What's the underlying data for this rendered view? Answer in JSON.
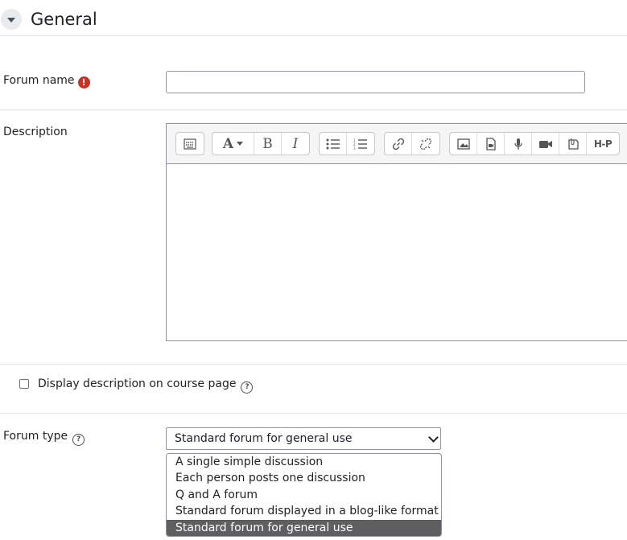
{
  "section": {
    "title": "General"
  },
  "forum_name": {
    "label": "Forum name",
    "value": "",
    "required_mark": "!"
  },
  "description": {
    "label": "Description",
    "value": ""
  },
  "toolbar": {
    "groups": [
      [
        "toggle-toolbar-icon"
      ],
      [
        "font-style-icon",
        "bold-icon",
        "italic-icon"
      ],
      [
        "unordered-list-icon",
        "ordered-list-icon"
      ],
      [
        "link-icon",
        "unlink-icon"
      ],
      [
        "image-icon",
        "media-icon",
        "record-audio-icon",
        "record-video-icon",
        "manage-files-icon",
        "h5p-icon"
      ]
    ],
    "bold_label": "B",
    "italic_label": "I",
    "font_label": "A",
    "h5p_label": "H-P"
  },
  "display_description": {
    "label": "Display description on course page",
    "checked": false,
    "help": "?"
  },
  "forum_type": {
    "label": "Forum type",
    "help": "?",
    "selected": "Standard forum for general use",
    "options": [
      "A single simple discussion",
      "Each person posts one discussion",
      "Q and A forum",
      "Standard forum displayed in a blog-like format",
      "Standard forum for general use"
    ],
    "highlighted_index": 4
  },
  "colors": {
    "required": "#ca3120",
    "border": "#8f959e",
    "highlight": "#5f5f5f"
  }
}
